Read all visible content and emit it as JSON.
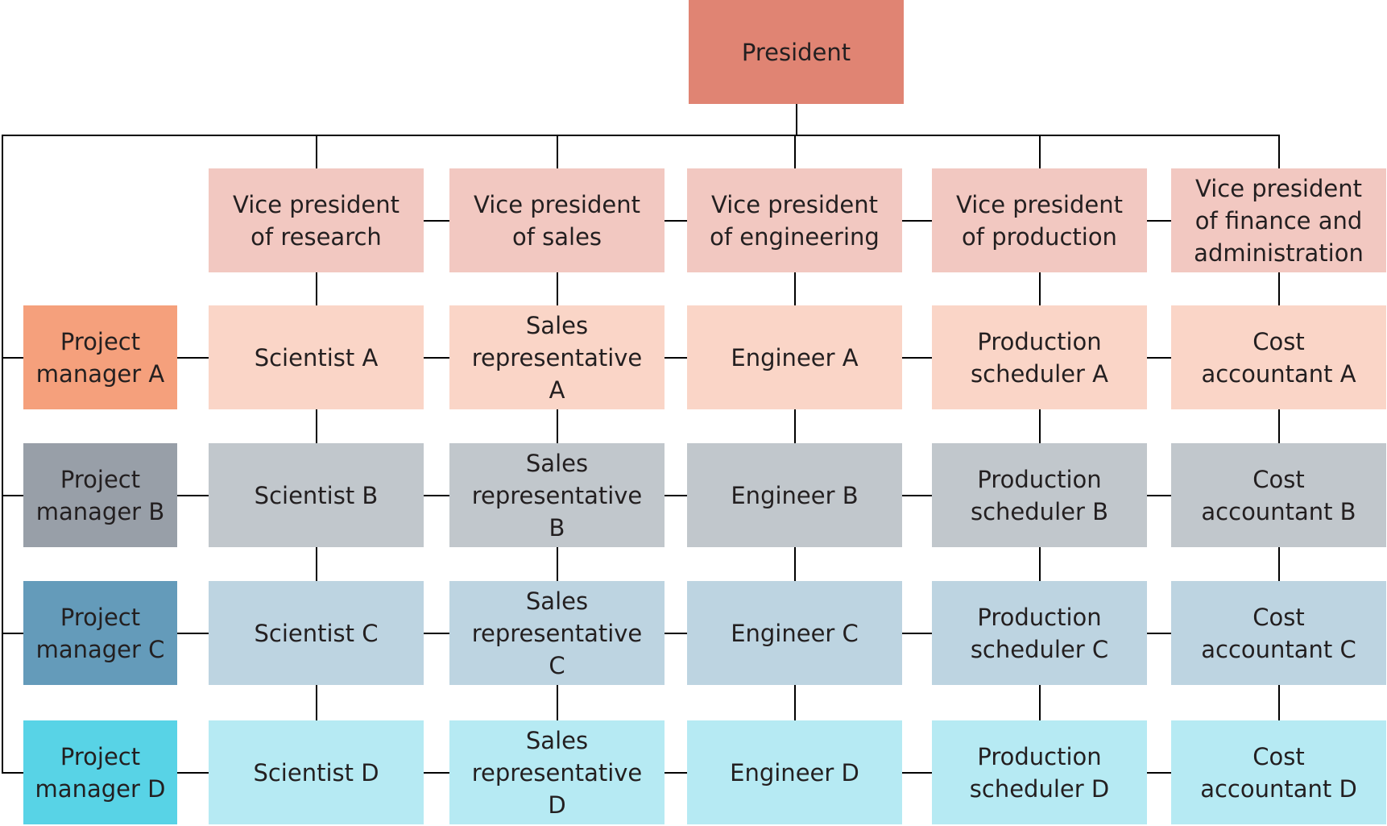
{
  "chart_data": {
    "type": "org-chart",
    "title": "",
    "root": {
      "id": "president",
      "label": "President",
      "color": "#E08473"
    },
    "vice_presidents": [
      {
        "id": "vp-research",
        "label": "Vice president\nof research"
      },
      {
        "id": "vp-sales",
        "label": "Vice president\nof sales"
      },
      {
        "id": "vp-engineering",
        "label": "Vice president\nof engineering"
      },
      {
        "id": "vp-production",
        "label": "Vice president\nof production"
      },
      {
        "id": "vp-finance",
        "label": "Vice president\nof finance and\nadministration"
      }
    ],
    "vp_color": "#F2C8C1",
    "projects": [
      {
        "id": "a",
        "manager": "Project\nmanager A",
        "manager_color": "#F5A07C",
        "cell_color": "#FAD5C7",
        "members": [
          "Scientist A",
          "Sales\nrepresentative\nA",
          "Engineer A",
          "Production\nscheduler A",
          "Cost\naccountant A"
        ]
      },
      {
        "id": "b",
        "manager": "Project\nmanager B",
        "manager_color": "#989FA8",
        "cell_color": "#C1C7CC",
        "members": [
          "Scientist B",
          "Sales\nrepresentative\nB",
          "Engineer B",
          "Production\nscheduler B",
          "Cost\naccountant B"
        ]
      },
      {
        "id": "c",
        "manager": "Project\nmanager C",
        "manager_color": "#649BBA",
        "cell_color": "#BDD4E1",
        "members": [
          "Scientist C",
          "Sales\nrepresentative\nC",
          "Engineer C",
          "Production\nscheduler C",
          "Cost\naccountant C"
        ]
      },
      {
        "id": "d",
        "manager": "Project\nmanager D",
        "manager_color": "#58D3E6",
        "cell_color": "#B6EAF3",
        "members": [
          "Scientist D",
          "Sales\nrepresentative\nD",
          "Engineer D",
          "Production\nscheduler D",
          "Cost\naccountant D"
        ]
      }
    ],
    "line_color": "#000000"
  }
}
